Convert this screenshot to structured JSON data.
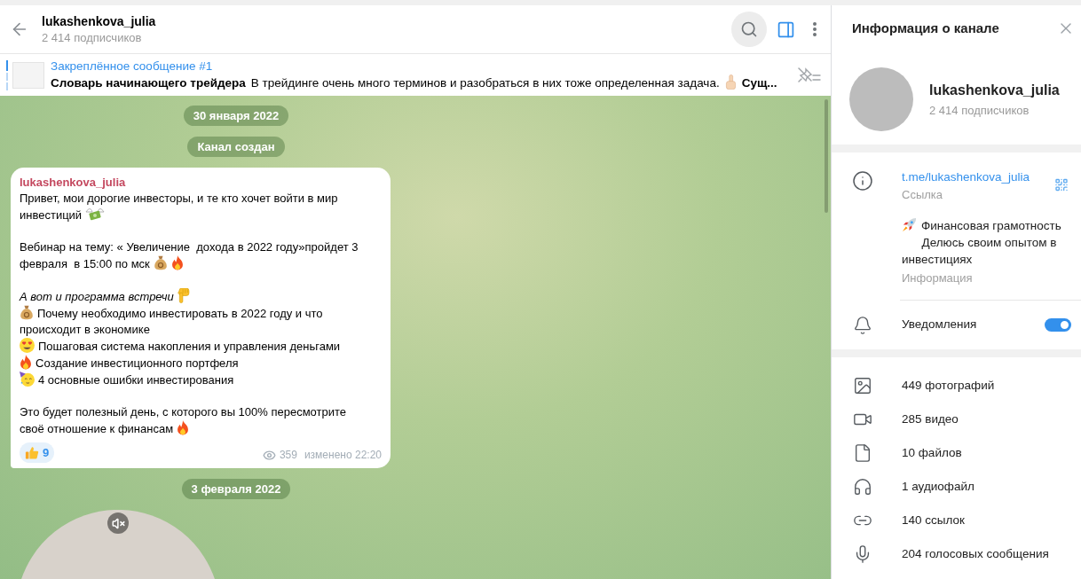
{
  "header": {
    "title": "lukashenkova_julia",
    "subtitle": "2 414 подписчиков"
  },
  "pinned": {
    "title": "Закреплённое сообщение #1",
    "segments": [
      {
        "kind": "text",
        "text": "Словарь начинающего трейдера",
        "bold": true
      },
      {
        "kind": "text",
        "text": "В трейдинге очень много терминов и разобраться в них тоже определенная задача.",
        "bold": false
      },
      {
        "kind": "pointup"
      },
      {
        "kind": "text",
        "text": "Сущ...",
        "bold": true
      }
    ]
  },
  "chat": {
    "items": [
      {
        "kind": "date",
        "text": "30 января 2022"
      },
      {
        "kind": "service",
        "text": "Канал создан"
      },
      {
        "kind": "message",
        "author": "lukashenkova_julia",
        "blocks": [
          [
            {
              "italic": false,
              "segments": [
                {
                  "kind": "text",
                  "text": "Привет, мои дорогие инвесторы, и те кто хочет войти в мир"
                }
              ]
            },
            {
              "italic": false,
              "segments": [
                {
                  "kind": "text",
                  "text": "инвестиций"
                },
                {
                  "kind": "moneywings"
                }
              ]
            }
          ],
          [
            {
              "italic": false,
              "segments": [
                {
                  "kind": "text",
                  "text": "Вебинар на тему: « Увеличение  дохода в 2022 году»пройдет 3"
                }
              ]
            },
            {
              "italic": false,
              "segments": [
                {
                  "kind": "text",
                  "text": "февраля  в 15:00 по мск"
                },
                {
                  "kind": "moneybag"
                },
                {
                  "kind": "fire"
                }
              ]
            }
          ],
          [
            {
              "italic": true,
              "segments": [
                {
                  "kind": "text",
                  "text": "А вот и программа встречи"
                },
                {
                  "kind": "pointdown"
                }
              ]
            },
            {
              "italic": false,
              "segments": [
                {
                  "kind": "moneybag"
                },
                {
                  "kind": "text",
                  "text": "Почему необходимо инвестировать в 2022 году и что"
                }
              ]
            },
            {
              "italic": false,
              "segments": [
                {
                  "kind": "text",
                  "text": "происходит в экономике"
                }
              ]
            },
            {
              "italic": false,
              "segments": [
                {
                  "kind": "hearteyes"
                },
                {
                  "kind": "text",
                  "text": "Пошаговая система накопления и управления деньгами"
                }
              ]
            },
            {
              "italic": false,
              "segments": [
                {
                  "kind": "fire"
                },
                {
                  "kind": "text",
                  "text": "Создание инвестиционного портфеля"
                }
              ]
            },
            {
              "italic": false,
              "segments": [
                {
                  "kind": "party"
                },
                {
                  "kind": "text",
                  "text": "4 основные ошибки инвестирования"
                }
              ]
            }
          ],
          [
            {
              "italic": false,
              "segments": [
                {
                  "kind": "text",
                  "text": "Это будет полезный день, с которого вы 100% пересмотрите"
                }
              ]
            },
            {
              "italic": false,
              "segments": [
                {
                  "kind": "text",
                  "text": "своё отношение к финансам"
                },
                {
                  "kind": "fire"
                }
              ]
            }
          ]
        ],
        "reaction": {
          "kind": "thumbsup",
          "count": "9"
        },
        "views": "359",
        "edited": "изменено 22:20"
      },
      {
        "kind": "date",
        "text": "3 февраля 2022"
      },
      {
        "kind": "video",
        "muted": true
      }
    ]
  },
  "info_panel": {
    "title": "Информация о канале",
    "profile": {
      "name": "lukashenkova_julia",
      "subtitle": "2 414 подписчиков"
    },
    "link": "t.me/lukashenkova_julia",
    "link_label": "Ссылка",
    "description": [
      {
        "segments": [
          {
            "kind": "rocket"
          },
          {
            "kind": "text",
            "text": "Финансовая грамотность"
          }
        ]
      },
      {
        "segments": [
          {
            "kind": "text",
            "text": "      Делюсь своим опытом в инвестициях"
          }
        ]
      }
    ],
    "description_label": "Информация",
    "notifications": {
      "label": "Уведомления",
      "on": true
    },
    "media": [
      {
        "kind": "photos",
        "label": "449 фотографий"
      },
      {
        "kind": "videos",
        "label": "285 видео"
      },
      {
        "kind": "files",
        "label": "10 файлов"
      },
      {
        "kind": "audio",
        "label": "1 аудиофайл"
      },
      {
        "kind": "links",
        "label": "140 ссылок"
      },
      {
        "kind": "voice",
        "label": "204 голосовых сообщения"
      }
    ]
  }
}
